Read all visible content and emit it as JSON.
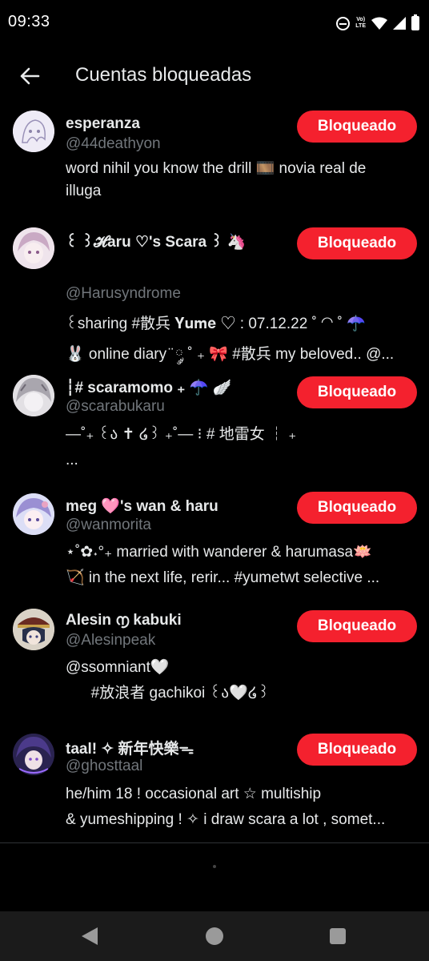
{
  "status": {
    "time": "09:33",
    "volte_top": "Vo)",
    "volte_bottom": "LTE"
  },
  "header": {
    "title": "Cuentas bloqueadas"
  },
  "button_label": "Bloqueado",
  "accent": "#f4212e",
  "users": [
    {
      "name": "esperanza",
      "handle": "@44deathyon",
      "bio": [
        "word nihil you know the drill 🎞️ novia real de",
        "illuga"
      ]
    },
    {
      "name": "꒰ ꒱𝓗aru ♡'s Scara ꒱ 🦄",
      "handle": "@Harusyndrome",
      "bio": [
        "꒰sharing #散兵 𝐘𝐮𝐦𝐞 ♡ : 07.12.22 ˚ ◠ ˚ ☂️",
        "🐰 online diary ̈ ༘ ˚ ₊ 🎀 #散兵 my beloved..    @..."
      ]
    },
    {
      "name": "┆# scaramomo ₊ ☂️ 🪽",
      "handle": "@scarabukaru",
      "bio": [
        "—˚₊ ꒰ა ✝ ໒꒱ ₊˚—   ⁝ # 地雷女 ┆ ₊",
        "..."
      ]
    },
    {
      "name": "meg 🩷's wan & haru",
      "handle": "@wanmorita",
      "bio": [
        "⋆˚✿˖°₊ married with wanderer & harumasa🪷",
        "🏹 in the next life, rerir... #yumetwt selective ..."
      ]
    },
    {
      "name": "Alesin ൱ kabuki",
      "handle": "@Alesinpeak",
      "bio": [
        "@ssomniant🤍",
        "      #放浪者 gachikoi ꒰ა🤍໒꒱"
      ]
    },
    {
      "name": "taal! ✧ 新年快樂ᯓ",
      "handle": "@ghosttaal",
      "bio": [
        "he/him 18 ! occasional art ☆ multiship",
        "& yumeshipping ! ✧ i draw scara a lot , somet..."
      ]
    }
  ]
}
